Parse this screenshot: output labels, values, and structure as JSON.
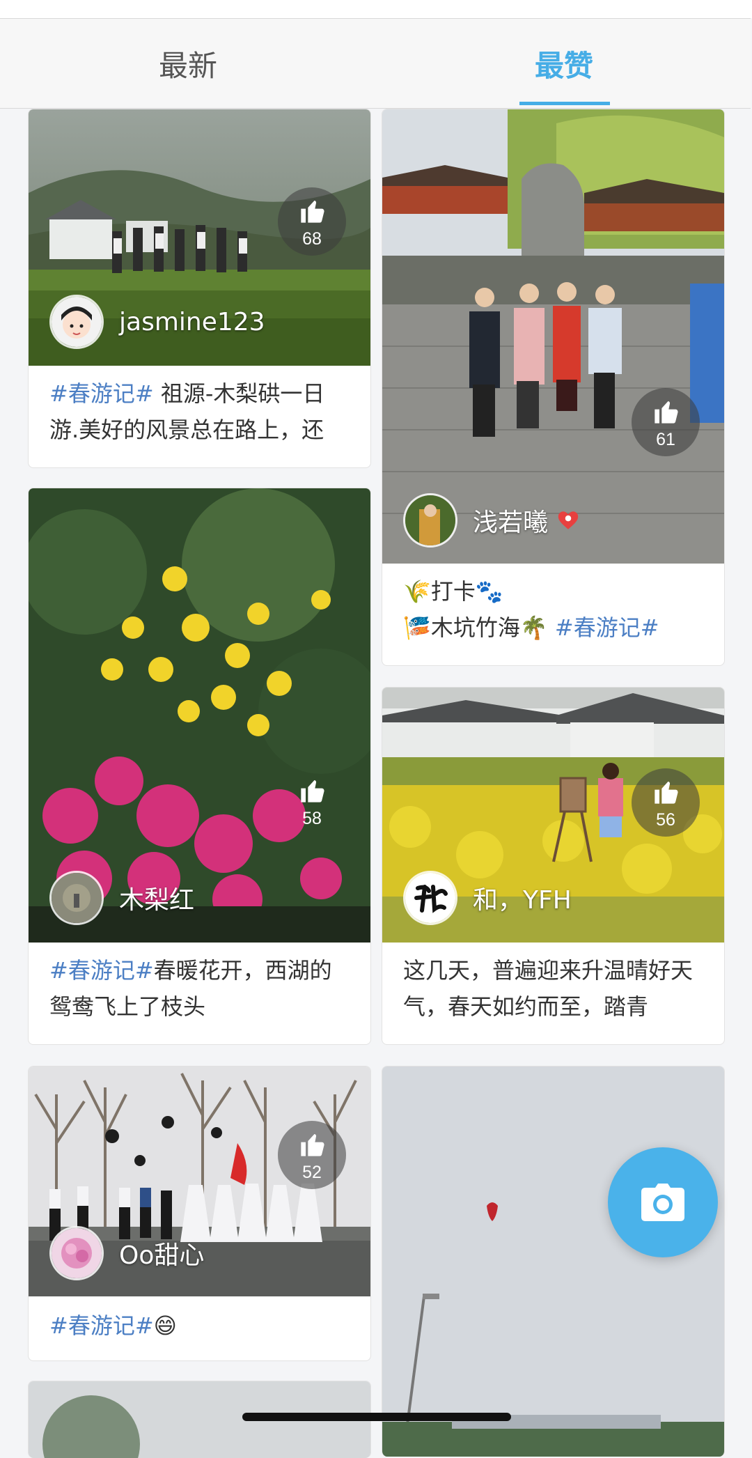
{
  "tabs": {
    "latest": "最新",
    "top": "最赞"
  },
  "posts": [
    {
      "user": "jasmine123",
      "likes": "68",
      "tag": "#春游记#",
      "text": " 祖源-木梨硔一日游.美好的风景总在路上，还"
    },
    {
      "user": "浅若曦",
      "likes": "61",
      "line1": "打卡",
      "line2": "木坑竹海",
      "tag": "#春游记#"
    },
    {
      "user": "木梨红",
      "likes": "58",
      "tag": "#春游记#",
      "text": "春暖花开，西湖的鸳鸯飞上了枝头"
    },
    {
      "user": "和，YFH",
      "likes": "56",
      "text": "这几天，普遍迎来升温晴好天气，春天如约而至，踏青"
    },
    {
      "user": "Oo甜心",
      "likes": "52",
      "tag": "#春游记#",
      "emoji": "😄"
    }
  ],
  "icons": {
    "like": "thumbs-up-icon",
    "camera": "camera-icon",
    "verified": "heart-badge-icon"
  },
  "colors": {
    "accent": "#46ade6",
    "hashtag": "#4c7fc4",
    "fab": "#4ab2ea"
  }
}
